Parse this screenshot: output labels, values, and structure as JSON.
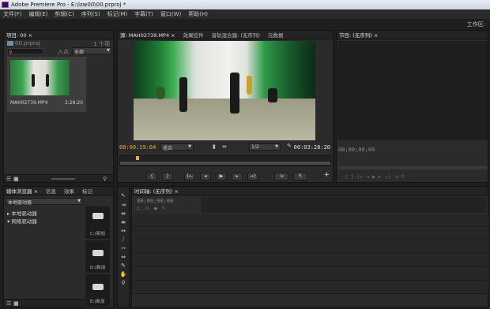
{
  "app": {
    "title": "Adobe Premiere Pro - E:\\lzw00\\00.prproj *"
  },
  "menu": [
    "文件(F)",
    "编辑(E)",
    "剪辑(C)",
    "序列(S)",
    "标记(M)",
    "字幕(T)",
    "窗口(W)",
    "帮助(H)"
  ],
  "workspace_label": "工作区:",
  "project": {
    "tab": "项目: 00 ×",
    "file": "00.prproj",
    "count": "1 个项",
    "in_label": "入点:",
    "in_value": "全部",
    "clip_name": "MAH02739.MP4",
    "clip_duration": "3:28:20"
  },
  "source": {
    "tabs": [
      "源: MAH02739.MP4 ×",
      "效果控件",
      "音轨混合器: (无序列)",
      "元数据"
    ],
    "timecode_in": "00:00:19:04",
    "fit": "适合",
    "resolution": "1/2",
    "timecode_out": "00:03:28:20"
  },
  "program": {
    "tab": "节目: (无序列) ×",
    "timecode": "00;00;00;00"
  },
  "media_browser": {
    "tabs": [
      "媒体浏览器 ×",
      "信息",
      "效果",
      "标记"
    ],
    "dropdown": "本地驱动器",
    "items": [
      "本地驱动器",
      "网络驱动器"
    ],
    "drives": [
      "C:(新加",
      "D:(新加",
      "E:(新加"
    ]
  },
  "timeline": {
    "tab": "时间轴: (无序列) ×",
    "timecode": "00;00;00;00"
  }
}
